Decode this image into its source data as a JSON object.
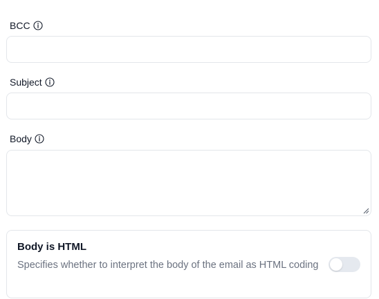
{
  "fields": {
    "bcc": {
      "label": "BCC",
      "value": "",
      "info_icon": "info-icon"
    },
    "subject": {
      "label": "Subject",
      "value": "",
      "info_icon": "info-icon"
    },
    "body": {
      "label": "Body",
      "value": "",
      "info_icon": "info-icon"
    }
  },
  "body_is_html": {
    "title": "Body is HTML",
    "description": "Specifies whether to interpret the body of the email as HTML coding",
    "enabled": false
  },
  "colors": {
    "border": "#e3e6ea",
    "text": "#111827",
    "muted_text": "#6b7280",
    "toggle_off": "#e5e9ef"
  }
}
